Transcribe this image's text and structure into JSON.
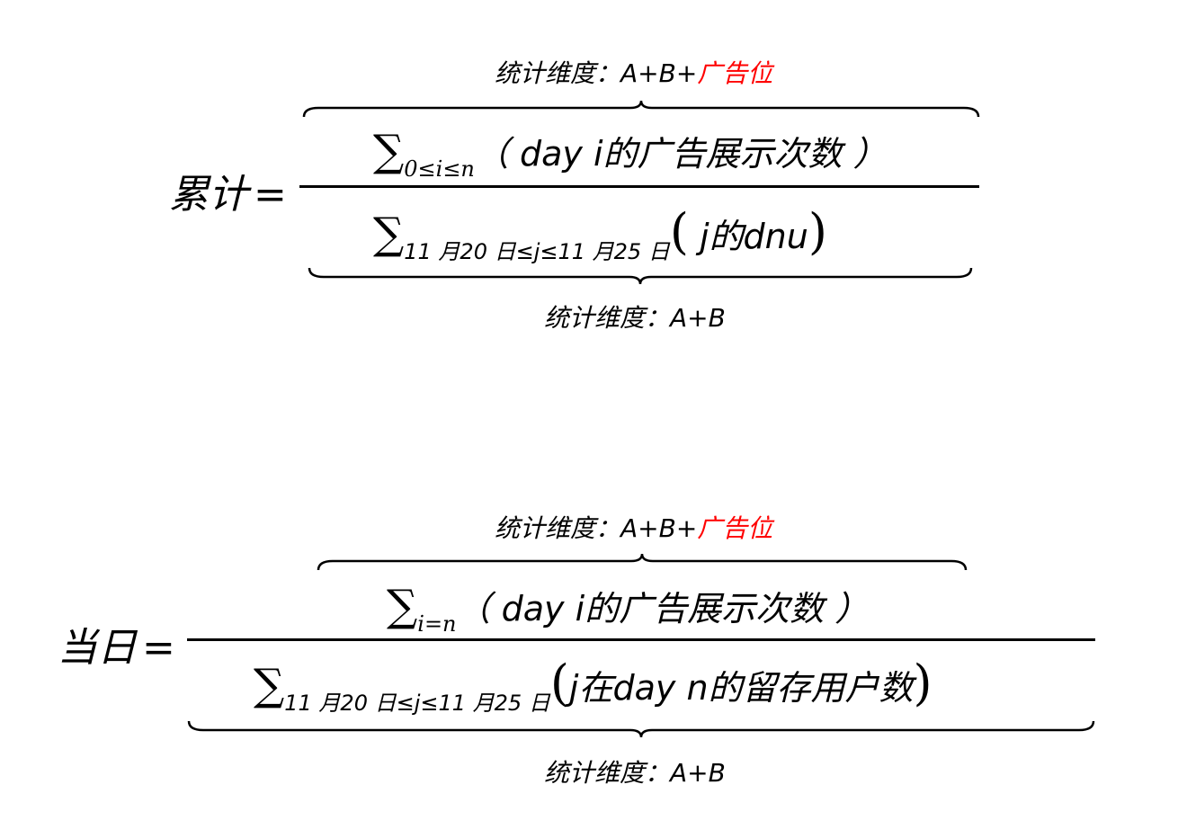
{
  "formula1": {
    "lhs": "累计",
    "equals": "=",
    "top_annotation": {
      "prefix": "统计维度：A+B+",
      "highlight": "广告位"
    },
    "bottom_annotation": "统计维度：A+B",
    "numerator": {
      "sigma": "∑",
      "subscript": "0≤i≤n",
      "text": "（ day i的广告展示次数 ）"
    },
    "denominator": {
      "sigma": "∑",
      "subscript": "11 月20 日≤j≤11 月25 日",
      "open": "(",
      "text": " j的dnu",
      "close": ")"
    }
  },
  "formula2": {
    "lhs": "当日",
    "equals": "=",
    "top_annotation": {
      "prefix": "统计维度：A+B+",
      "highlight": "广告位"
    },
    "bottom_annotation": "统计维度：A+B",
    "numerator": {
      "sigma": "∑",
      "subscript": "i=n",
      "text": "（ day i的广告展示次数 ）"
    },
    "denominator": {
      "sigma": "∑",
      "subscript": "11 月20 日≤j≤11 月25 日",
      "open": "(",
      "text": "j在day n的留存用户数",
      "close": ")"
    }
  },
  "colors": {
    "text": "#000000",
    "highlight": "#ff0000",
    "background": "#ffffff"
  }
}
